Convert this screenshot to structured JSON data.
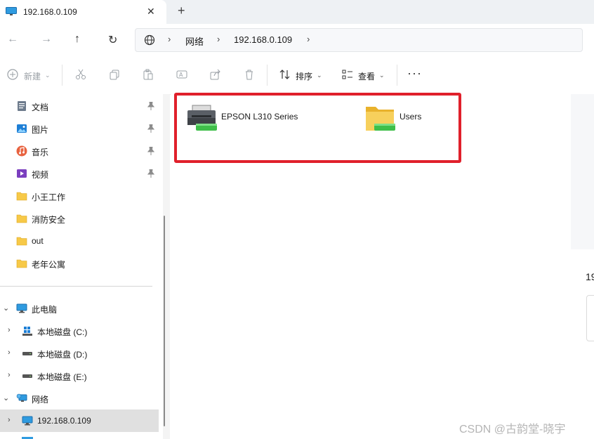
{
  "tab": {
    "title": "192.168.0.109",
    "close_glyph": "✕",
    "newtab_glyph": "+"
  },
  "nav": {
    "back_glyph": "←",
    "forward_glyph": "→",
    "up_glyph": "↑",
    "refresh_glyph": "↻"
  },
  "address": {
    "crumbs": [
      "网络",
      "192.168.0.109"
    ],
    "sep": "›"
  },
  "commandbar": {
    "new_label": "新建",
    "sort_label": "排序",
    "view_label": "查看",
    "more_glyph": "···"
  },
  "sidebar": {
    "quick_access": [
      {
        "label": "文档",
        "icon": "document-icon",
        "pinned": true
      },
      {
        "label": "图片",
        "icon": "pictures-icon",
        "pinned": true
      },
      {
        "label": "音乐",
        "icon": "music-icon",
        "pinned": true
      },
      {
        "label": "视频",
        "icon": "video-icon",
        "pinned": true
      },
      {
        "label": "小王工作",
        "icon": "folder-icon",
        "pinned": false
      },
      {
        "label": "消防安全",
        "icon": "folder-icon",
        "pinned": false
      },
      {
        "label": "out",
        "icon": "folder-icon",
        "pinned": false
      },
      {
        "label": "老年公寓",
        "icon": "folder-icon",
        "pinned": false
      }
    ],
    "this_pc": {
      "label": "此电脑",
      "drives": [
        "本地磁盘 (C:)",
        "本地磁盘 (D:)",
        "本地磁盘 (E:)"
      ]
    },
    "network": {
      "label": "网络",
      "children": [
        "192.168.0.109"
      ]
    }
  },
  "content": {
    "items": [
      {
        "name": "EPSON L310 Series",
        "icon": "printer-icon"
      },
      {
        "name": "Users",
        "icon": "shared-folder-icon"
      }
    ]
  },
  "details_pane": {
    "title": "19"
  },
  "watermark": "CSDN @古韵堂-晓宇",
  "colors": {
    "highlight_border": "#e0202b",
    "folder": "#f7c948",
    "share_bar": "#3fbf4a",
    "selected_bg": "#e0e0e0"
  }
}
